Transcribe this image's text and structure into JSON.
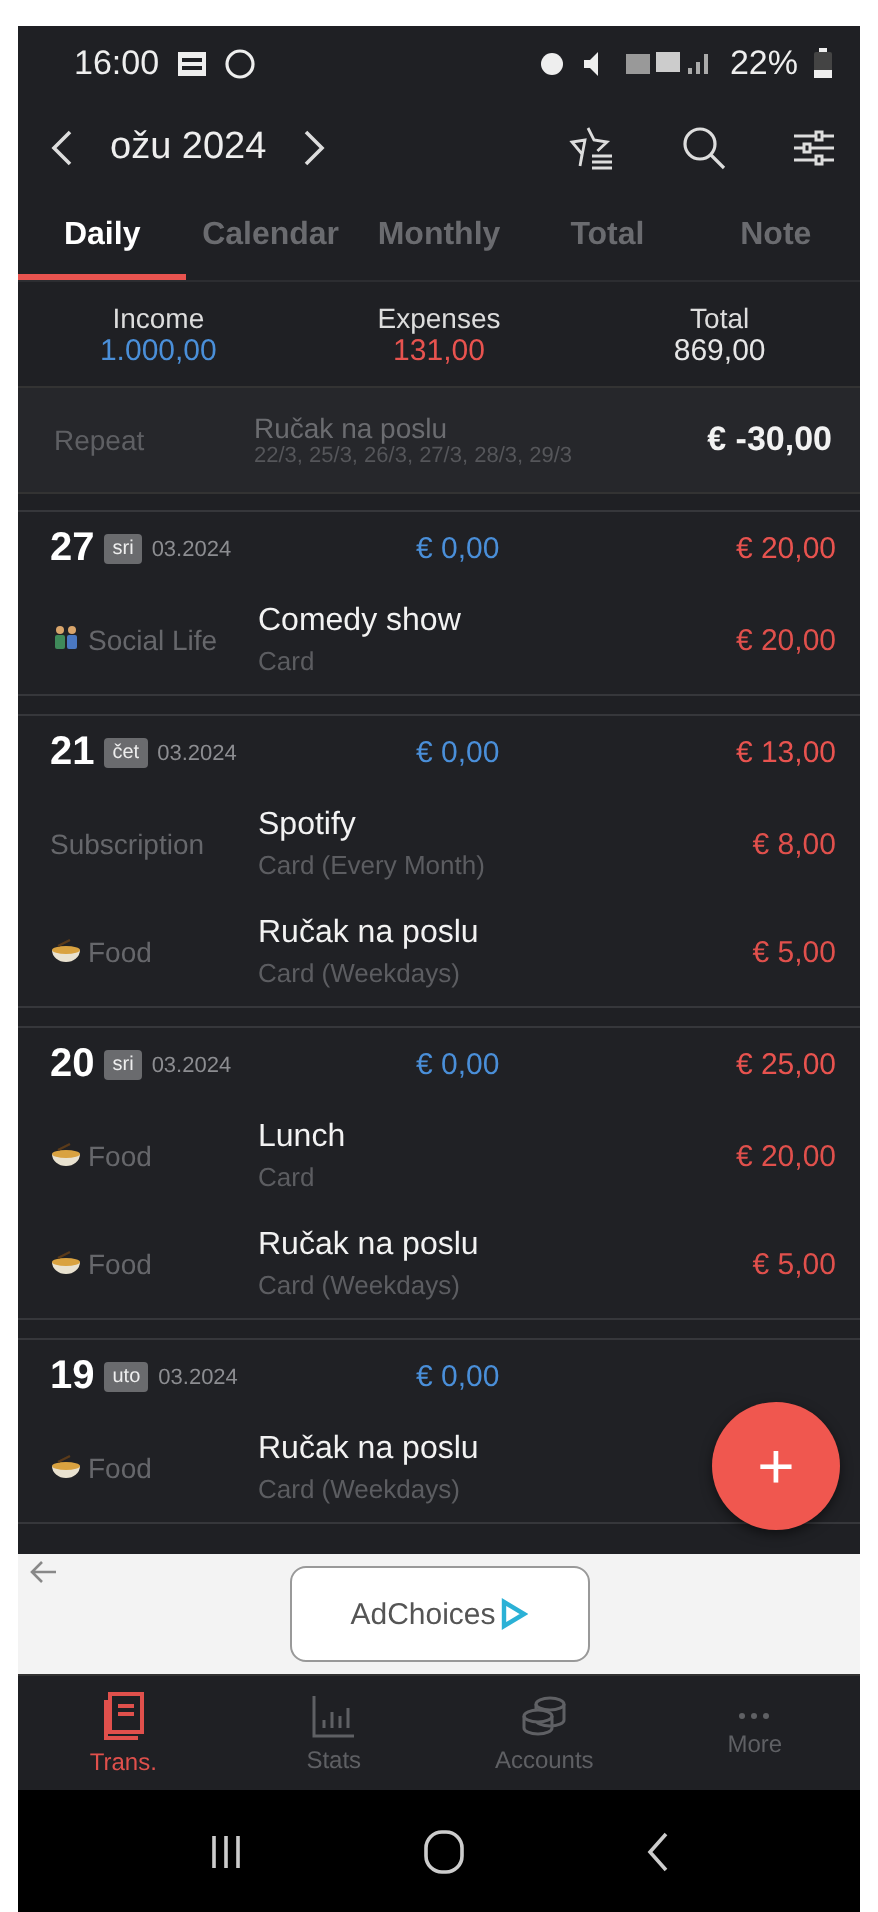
{
  "status_bar": {
    "time": "16:00",
    "battery": "22%"
  },
  "header": {
    "month": "ožu 2024"
  },
  "tabs": [
    {
      "label": "Daily",
      "selected": true
    },
    {
      "label": "Calendar",
      "selected": false
    },
    {
      "label": "Monthly",
      "selected": false
    },
    {
      "label": "Total",
      "selected": false
    },
    {
      "label": "Note",
      "selected": false
    }
  ],
  "summary": [
    {
      "label": "Income",
      "value": "1.000,00",
      "kind": "income"
    },
    {
      "label": "Expenses",
      "value": "131,00",
      "kind": "expense"
    },
    {
      "label": "Total",
      "value": "869,00",
      "kind": "total"
    }
  ],
  "repeat": {
    "label": "Repeat",
    "title": "Ručak na poslu",
    "dates": "22/3, 25/3, 26/3, 27/3, 28/3, 29/3",
    "amount": "€ -30,00"
  },
  "days": [
    {
      "day": "27",
      "weekday": "sri",
      "month": "03.2024",
      "income": "€ 0,00",
      "expense": "€ 20,00",
      "items": [
        {
          "kind": "people",
          "category": "Social Life",
          "title": "Comedy show",
          "note": "Card",
          "amount": "€ 20,00"
        }
      ]
    },
    {
      "day": "21",
      "weekday": "čet",
      "month": "03.2024",
      "income": "€ 0,00",
      "expense": "€ 13,00",
      "items": [
        {
          "kind": "plain",
          "category": "Subscription",
          "title": "Spotify",
          "note": "Card (Every Month)",
          "amount": "€ 8,00"
        },
        {
          "kind": "bowl",
          "category": "Food",
          "title": "Ručak na poslu",
          "note": "Card (Weekdays)",
          "amount": "€ 5,00"
        }
      ]
    },
    {
      "day": "20",
      "weekday": "sri",
      "month": "03.2024",
      "income": "€ 0,00",
      "expense": "€ 25,00",
      "items": [
        {
          "kind": "bowl",
          "category": "Food",
          "title": "Lunch",
          "note": "Card",
          "amount": "€ 20,00"
        },
        {
          "kind": "bowl",
          "category": "Food",
          "title": "Ručak na poslu",
          "note": "Card (Weekdays)",
          "amount": "€ 5,00"
        }
      ]
    },
    {
      "day": "19",
      "weekday": "uto",
      "month": "03.2024",
      "income": "€ 0,00",
      "items": [
        {
          "kind": "bowl",
          "category": "Food",
          "title": "Ručak na poslu",
          "note": "Card (Weekdays)"
        }
      ]
    }
  ],
  "fab": {
    "label": "+"
  },
  "ad": {
    "label": "AdChoices"
  },
  "bottom_nav": [
    {
      "label": "Trans.",
      "kind": "book",
      "selected": true
    },
    {
      "label": "Stats",
      "kind": "chart",
      "selected": false
    },
    {
      "label": "Accounts",
      "kind": "coins",
      "selected": false
    },
    {
      "label": "More",
      "kind": "dots",
      "selected": false
    }
  ]
}
